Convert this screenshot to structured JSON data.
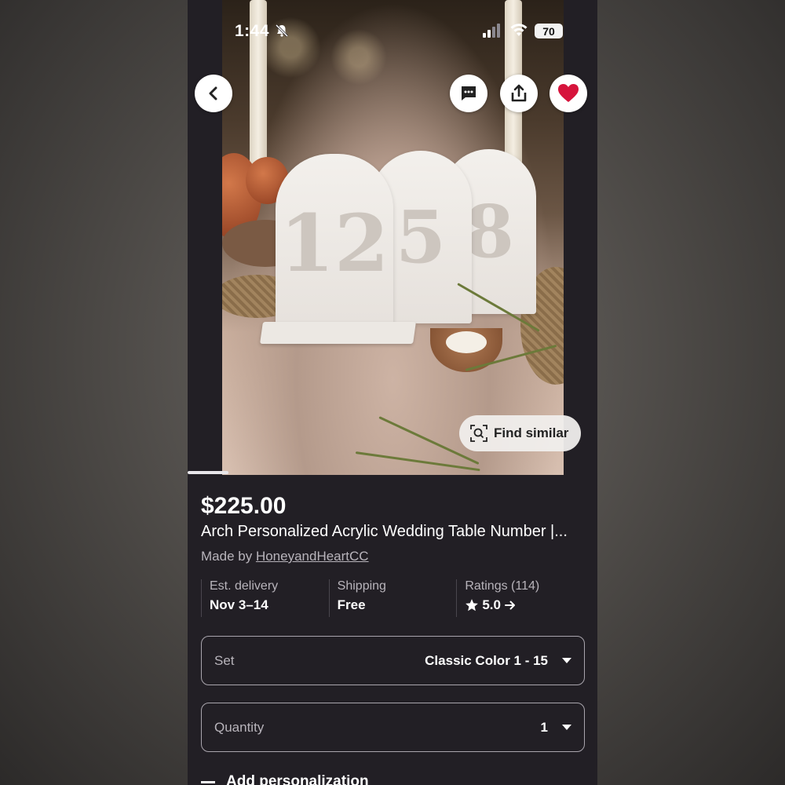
{
  "status_bar": {
    "time": "1:44",
    "battery": "70"
  },
  "listing": {
    "price": "$225.00",
    "title": "Arch Personalized Acrylic Wedding Table Number |...",
    "made_by_prefix": "Made by ",
    "shop_name": "HoneyandHeartCC",
    "image_numbers": [
      "12",
      "5",
      "8"
    ]
  },
  "actions": {
    "find_similar": "Find similar"
  },
  "stats": {
    "delivery": {
      "label": "Est. delivery",
      "value": "Nov 3–14"
    },
    "shipping": {
      "label": "Shipping",
      "value": "Free"
    },
    "ratings": {
      "label": "Ratings (114)",
      "value": "5.0"
    }
  },
  "options": {
    "set": {
      "label": "Set",
      "value": "Classic Color 1 - 15"
    },
    "quantity": {
      "label": "Quantity",
      "value": "1"
    }
  },
  "personalization": {
    "label": "Add personalization"
  },
  "colors": {
    "background": "#221f25",
    "favorite": "#d6143c",
    "text_muted": "#b8b4bb"
  },
  "icons": [
    "back-icon",
    "message-icon",
    "share-icon",
    "heart-icon",
    "visual-search-icon",
    "star-icon",
    "arrow-right-icon",
    "chevron-down-icon",
    "bell-slash-icon",
    "signal-icon",
    "wifi-icon",
    "battery-icon"
  ]
}
